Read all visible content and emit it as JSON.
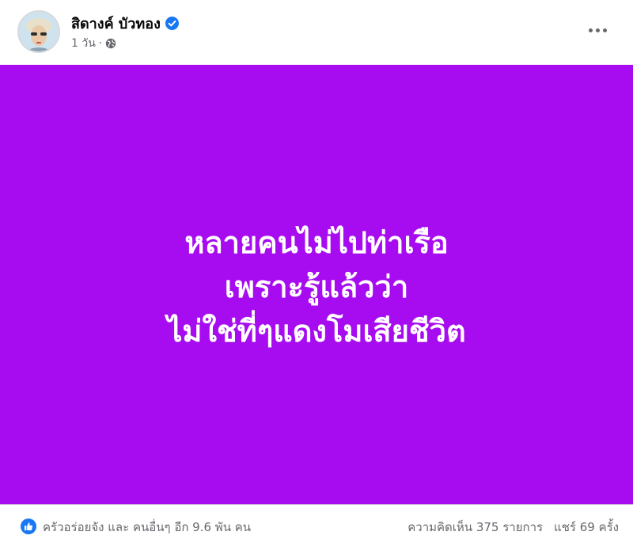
{
  "post": {
    "author": "สิดางค์ บัวทอง",
    "timestamp": "1 วัน",
    "separator": "·",
    "audience_icon": "globe-icon",
    "verified_icon": "verified-badge-icon",
    "more_icon": "more-options-icon"
  },
  "media": {
    "background": "#a70cf0",
    "text_color": "#ffffff",
    "lines": [
      "หลายคนไม่ไปท่าเรือ",
      "เพราะรู้แล้วว่า",
      "ไม่ใช่ที่ๆแดงโมเสียชีวิต"
    ]
  },
  "footer": {
    "reaction_icon": "like-icon",
    "reactors": "ครัวอร่อยจัง และ คนอื่นๆ อีก 9.6 พัน คน",
    "comments": "ความคิดเห็น 375 รายการ",
    "shares": "แชร์ 69 ครั้ง"
  },
  "colors": {
    "accent": "#1877f2",
    "secondary_text": "#65676b"
  }
}
